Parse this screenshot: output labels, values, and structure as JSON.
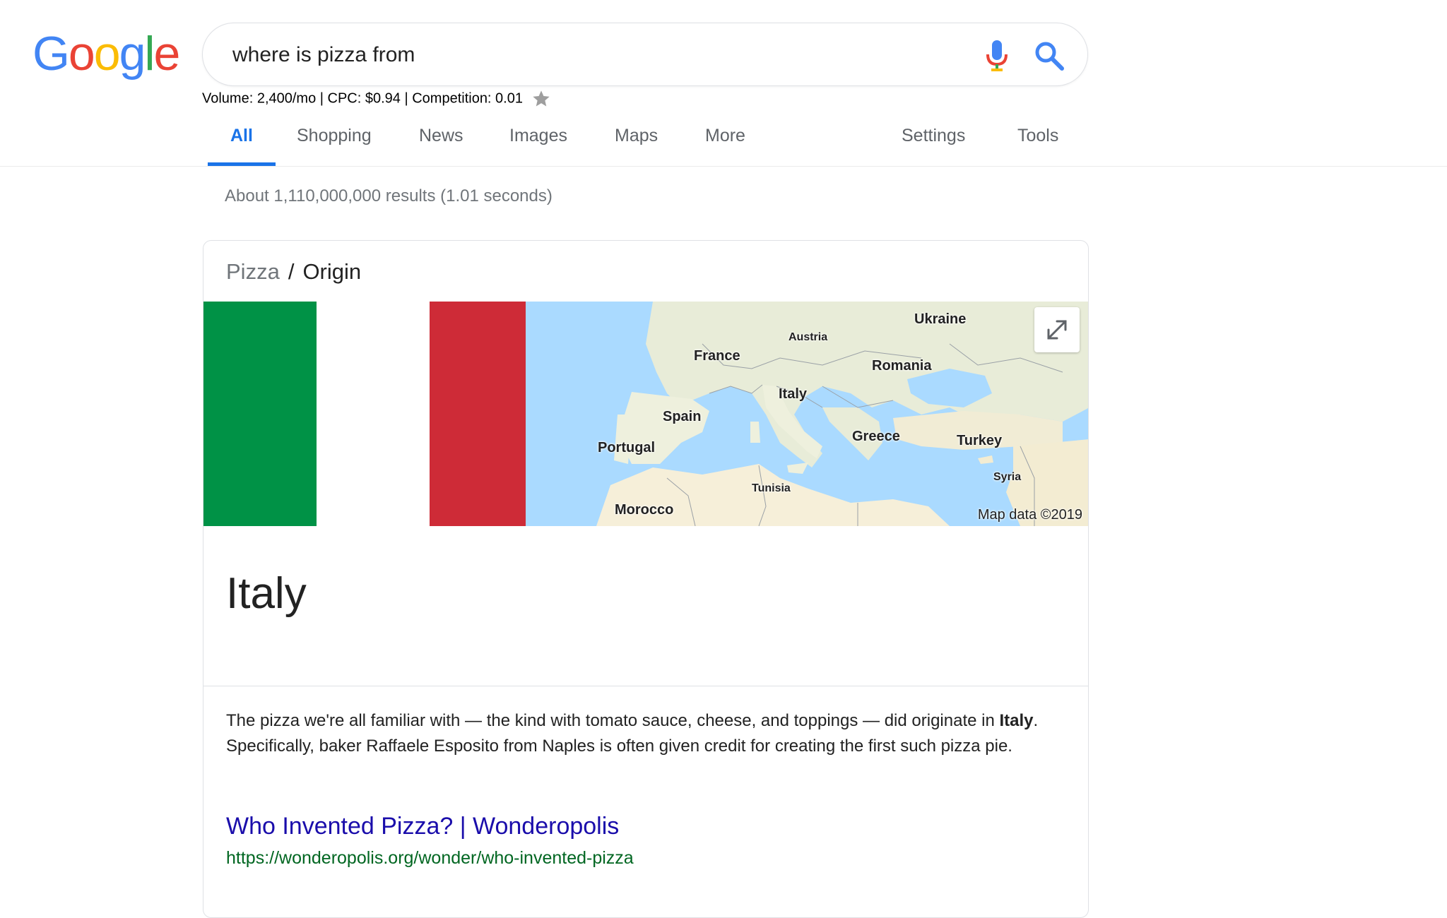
{
  "logo": {
    "letters": [
      "G",
      "o",
      "o",
      "g",
      "l",
      "e"
    ],
    "colors": [
      "#4285F4",
      "#EA4335",
      "#FBBC05",
      "#4285F4",
      "#34A853",
      "#EA4335"
    ]
  },
  "search": {
    "query": "where is pizza from"
  },
  "seo_bar": {
    "text": "Volume: 2,400/mo | CPC: $0.94 | Competition: 0.01"
  },
  "tabs": {
    "items": [
      {
        "label": "All",
        "active": true
      },
      {
        "label": "Shopping"
      },
      {
        "label": "News"
      },
      {
        "label": "Images"
      },
      {
        "label": "Maps"
      },
      {
        "label": "More"
      }
    ],
    "right": [
      {
        "label": "Settings"
      },
      {
        "label": "Tools"
      }
    ]
  },
  "stats": "About 1,110,000,000 results (1.01 seconds)",
  "card": {
    "breadcrumb": {
      "parent": "Pizza",
      "separator": "/",
      "current": "Origin"
    },
    "flag_colors": [
      "#009246",
      "#ffffff",
      "#ce2b37"
    ],
    "map": {
      "labels": {
        "ukraine": "Ukraine",
        "austria": "Austria",
        "france": "France",
        "romania": "Romania",
        "italy": "Italy",
        "spain": "Spain",
        "greece": "Greece",
        "turkey": "Turkey",
        "portugal": "Portugal",
        "syria": "Syria",
        "tunisia": "Tunisia",
        "morocco": "Morocco"
      },
      "attribution": "Map data ©2019"
    },
    "answer": "Italy",
    "snippet": {
      "part1": "The pizza we're all familiar with — the kind with tomato sauce, cheese, and toppings — did originate in ",
      "bold": "Italy",
      "part2": ". Specifically, baker Raffaele Esposito from Naples is often given credit for creating the first such pizza pie."
    },
    "result": {
      "title": "Who Invented Pizza? | Wonderopolis",
      "url": "https://wonderopolis.org/wonder/who-invented-pizza"
    }
  }
}
